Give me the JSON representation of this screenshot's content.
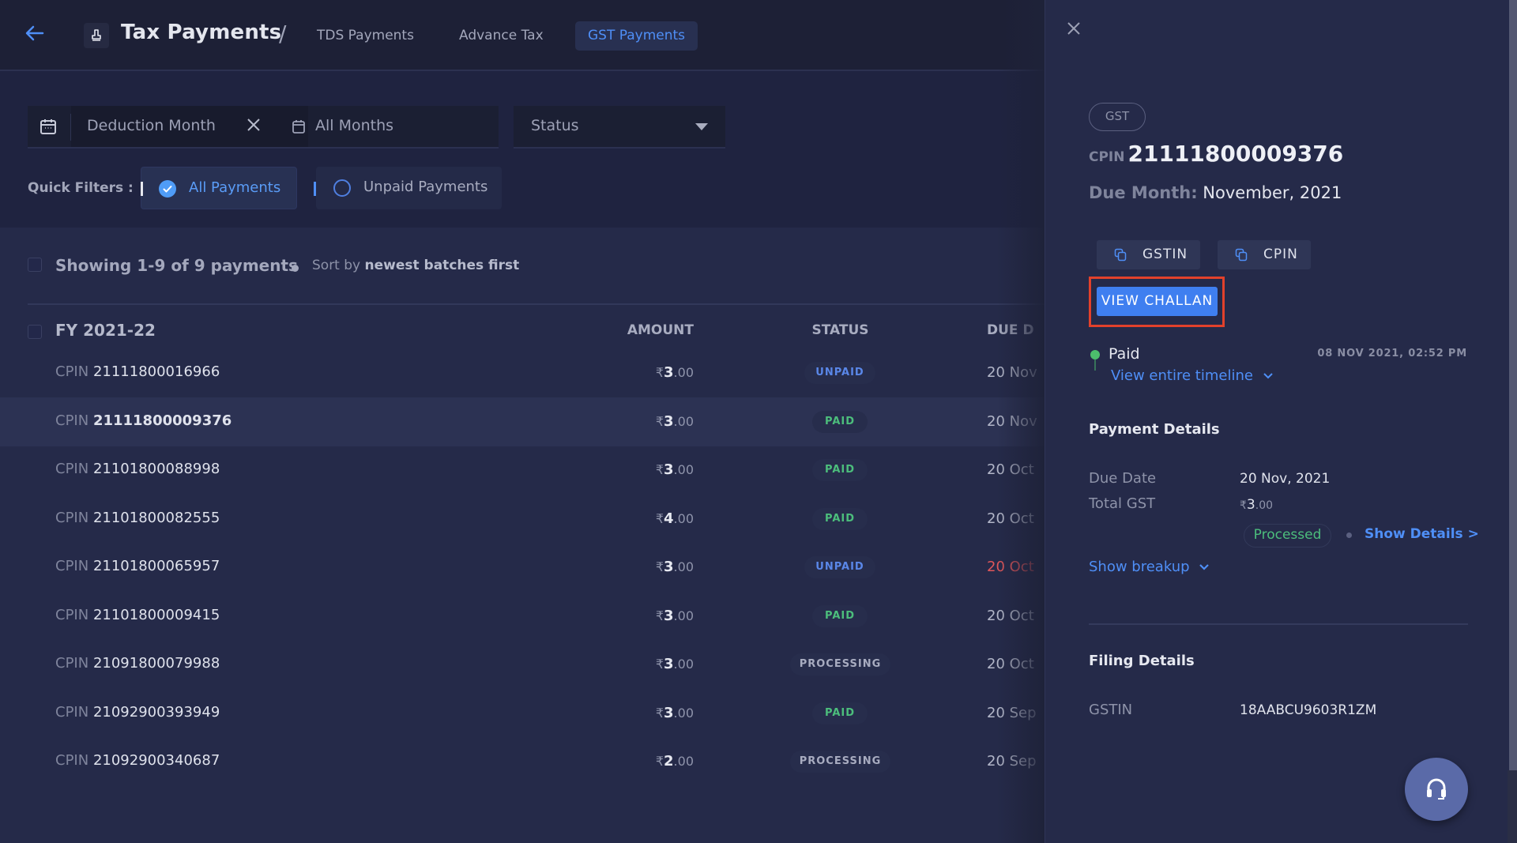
{
  "header": {
    "title": "Tax Payments",
    "separator": "/",
    "tabs": [
      {
        "label": "TDS Payments",
        "active": false
      },
      {
        "label": "Advance Tax",
        "active": false
      },
      {
        "label": "GST Payments",
        "active": true
      }
    ]
  },
  "filters": {
    "deduction_month_label": "Deduction Month",
    "month_value": "All Months",
    "status_placeholder": "Status",
    "quick_filters_label": "Quick Filters :",
    "quick_filters": [
      {
        "label": "All Payments",
        "selected": true
      },
      {
        "label": "Unpaid Payments",
        "selected": false
      }
    ]
  },
  "list": {
    "showing_text": "Showing 1-9 of 9 payments",
    "sort_prefix": "Sort by",
    "sort_value": "newest batches first",
    "group_label": "FY 2021-22",
    "columns": {
      "amount": "AMOUNT",
      "status": "STATUS",
      "due": "DUE D"
    },
    "cpin_prefix": "CPIN",
    "currency": "₹",
    "rows": [
      {
        "cpin": "21111800016966",
        "amount_main": "3",
        "amount_dec": ".00",
        "status": "UNPAID",
        "status_type": "unpaid",
        "due": "20 Nov",
        "overdue": false,
        "selected": false
      },
      {
        "cpin": "21111800009376",
        "amount_main": "3",
        "amount_dec": ".00",
        "status": "PAID",
        "status_type": "paid",
        "due": "20 Nov",
        "overdue": false,
        "selected": true
      },
      {
        "cpin": "21101800088998",
        "amount_main": "3",
        "amount_dec": ".00",
        "status": "PAID",
        "status_type": "paid",
        "due": "20 Oct",
        "overdue": false,
        "selected": false
      },
      {
        "cpin": "21101800082555",
        "amount_main": "4",
        "amount_dec": ".00",
        "status": "PAID",
        "status_type": "paid",
        "due": "20 Oct",
        "overdue": false,
        "selected": false
      },
      {
        "cpin": "21101800065957",
        "amount_main": "3",
        "amount_dec": ".00",
        "status": "UNPAID",
        "status_type": "unpaid",
        "due": "20 Oct",
        "overdue": true,
        "selected": false
      },
      {
        "cpin": "21101800009415",
        "amount_main": "3",
        "amount_dec": ".00",
        "status": "PAID",
        "status_type": "paid",
        "due": "20 Oct",
        "overdue": false,
        "selected": false
      },
      {
        "cpin": "21091800079988",
        "amount_main": "3",
        "amount_dec": ".00",
        "status": "PROCESSING",
        "status_type": "processing",
        "due": "20 Oct",
        "overdue": false,
        "selected": false
      },
      {
        "cpin": "21092900393949",
        "amount_main": "3",
        "amount_dec": ".00",
        "status": "PAID",
        "status_type": "paid",
        "due": "20 Sep",
        "overdue": false,
        "selected": false
      },
      {
        "cpin": "21092900340687",
        "amount_main": "2",
        "amount_dec": ".00",
        "status": "PROCESSING",
        "status_type": "processing",
        "due": "20 Sep",
        "overdue": false,
        "selected": false
      }
    ]
  },
  "panel": {
    "tag": "GST",
    "cpin_prefix": "CPIN",
    "cpin": "21111800009376",
    "due_month_label": "Due Month:",
    "due_month": "November, 2021",
    "copy_gstin_label": "GSTIN",
    "copy_cpin_label": "CPIN",
    "view_challan_label": "VIEW CHALLAN",
    "timeline_status": "Paid",
    "timeline_time": "08 NOV 2021, 02:52 PM",
    "timeline_link": "View entire timeline",
    "payment_details_title": "Payment Details",
    "due_date_label": "Due Date",
    "due_date": "20 Nov, 2021",
    "total_gst_label": "Total GST",
    "total_gst_currency": "₹",
    "total_gst_main": "3",
    "total_gst_dec": ".00",
    "processed_label": "Processed",
    "show_details_label": "Show Details >",
    "show_breakup_label": "Show breakup",
    "filing_details_title": "Filing Details",
    "gstin_label": "GSTIN",
    "gstin_value": "18AABCU9603R1ZM"
  },
  "colors": {
    "accent": "#4f8ff7",
    "paid": "#4cbe7c",
    "unpaid": "#5a87e8",
    "overdue": "#e0575a",
    "highlight": "#e2412b"
  }
}
